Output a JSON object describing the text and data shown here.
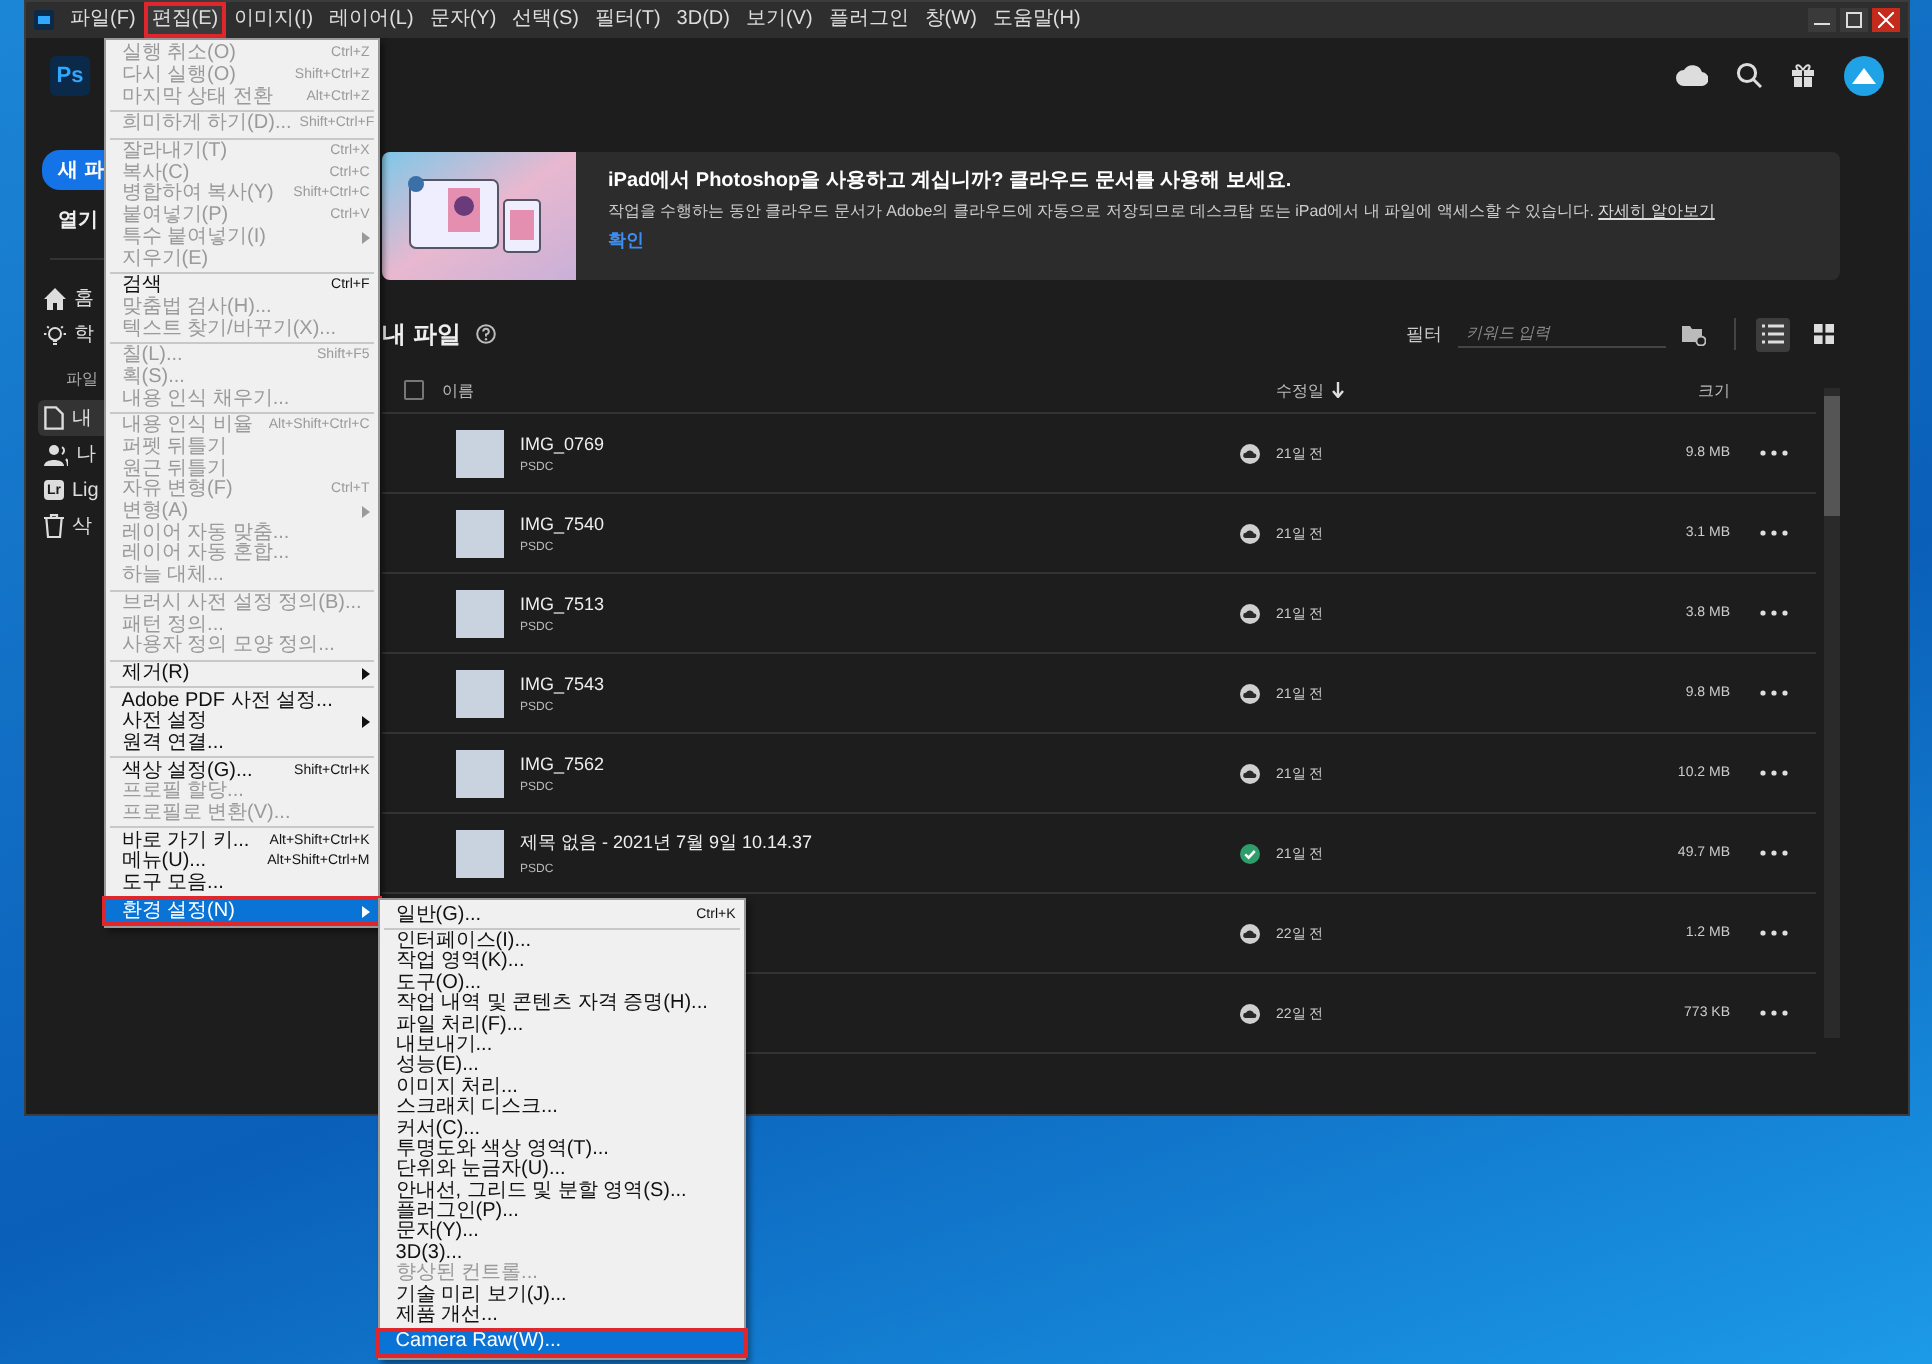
{
  "menu_bar": {
    "items": [
      {
        "label": "파일(F)",
        "selected": false
      },
      {
        "label": "편집(E)",
        "selected": true
      },
      {
        "label": "이미지(I)",
        "selected": false
      },
      {
        "label": "레이어(L)",
        "selected": false
      },
      {
        "label": "문자(Y)",
        "selected": false
      },
      {
        "label": "선택(S)",
        "selected": false
      },
      {
        "label": "필터(T)",
        "selected": false
      },
      {
        "label": "3D(D)",
        "selected": false
      },
      {
        "label": "보기(V)",
        "selected": false
      },
      {
        "label": "플러그인",
        "selected": false
      },
      {
        "label": "창(W)",
        "selected": false
      },
      {
        "label": "도움말(H)",
        "selected": false
      }
    ]
  },
  "edit_menu": {
    "items": [
      {
        "kind": "item",
        "label": "실행 취소(O)",
        "shortcut": "Ctrl+Z",
        "disabled": true,
        "submenu": false,
        "selected": false
      },
      {
        "kind": "item",
        "label": "다시 실행(O)",
        "shortcut": "Shift+Ctrl+Z",
        "disabled": true,
        "submenu": false,
        "selected": false
      },
      {
        "kind": "item",
        "label": "마지막 상태 전환",
        "shortcut": "Alt+Ctrl+Z",
        "disabled": true,
        "submenu": false,
        "selected": false
      },
      {
        "kind": "separator"
      },
      {
        "kind": "item",
        "label": "희미하게 하기(D)...",
        "shortcut": "Shift+Ctrl+F",
        "disabled": true,
        "submenu": false,
        "selected": false
      },
      {
        "kind": "separator"
      },
      {
        "kind": "item",
        "label": "잘라내기(T)",
        "shortcut": "Ctrl+X",
        "disabled": true,
        "submenu": false,
        "selected": false
      },
      {
        "kind": "item",
        "label": "복사(C)",
        "shortcut": "Ctrl+C",
        "disabled": true,
        "submenu": false,
        "selected": false
      },
      {
        "kind": "item",
        "label": "병합하여 복사(Y)",
        "shortcut": "Shift+Ctrl+C",
        "disabled": true,
        "submenu": false,
        "selected": false
      },
      {
        "kind": "item",
        "label": "붙여넣기(P)",
        "shortcut": "Ctrl+V",
        "disabled": true,
        "submenu": false,
        "selected": false
      },
      {
        "kind": "item",
        "label": "특수 붙여넣기(I)",
        "disabled": true,
        "submenu": true,
        "selected": false
      },
      {
        "kind": "item",
        "label": "지우기(E)",
        "disabled": true,
        "submenu": false,
        "selected": false
      },
      {
        "kind": "separator"
      },
      {
        "kind": "item",
        "label": "검색",
        "shortcut": "Ctrl+F",
        "disabled": false,
        "submenu": false,
        "selected": false
      },
      {
        "kind": "item",
        "label": "맞춤법 검사(H)...",
        "disabled": true,
        "submenu": false,
        "selected": false
      },
      {
        "kind": "item",
        "label": "텍스트 찾기/바꾸기(X)...",
        "disabled": true,
        "submenu": false,
        "selected": false
      },
      {
        "kind": "separator"
      },
      {
        "kind": "item",
        "label": "칠(L)...",
        "shortcut": "Shift+F5",
        "disabled": true,
        "submenu": false,
        "selected": false
      },
      {
        "kind": "item",
        "label": "획(S)...",
        "disabled": true,
        "submenu": false,
        "selected": false
      },
      {
        "kind": "item",
        "label": "내용 인식 채우기...",
        "disabled": true,
        "submenu": false,
        "selected": false
      },
      {
        "kind": "separator"
      },
      {
        "kind": "item",
        "label": "내용 인식 비율",
        "shortcut": "Alt+Shift+Ctrl+C",
        "disabled": true,
        "submenu": false,
        "selected": false
      },
      {
        "kind": "item",
        "label": "퍼펫 뒤틀기",
        "disabled": true,
        "submenu": false,
        "selected": false
      },
      {
        "kind": "item",
        "label": "원근 뒤틀기",
        "disabled": true,
        "submenu": false,
        "selected": false
      },
      {
        "kind": "item",
        "label": "자유 변형(F)",
        "shortcut": "Ctrl+T",
        "disabled": true,
        "submenu": false,
        "selected": false
      },
      {
        "kind": "item",
        "label": "변형(A)",
        "disabled": true,
        "submenu": true,
        "selected": false
      },
      {
        "kind": "item",
        "label": "레이어 자동 맞춤...",
        "disabled": true,
        "submenu": false,
        "selected": false
      },
      {
        "kind": "item",
        "label": "레이어 자동 혼합...",
        "disabled": true,
        "submenu": false,
        "selected": false
      },
      {
        "kind": "item",
        "label": "하늘 대체...",
        "disabled": true,
        "submenu": false,
        "selected": false
      },
      {
        "kind": "separator"
      },
      {
        "kind": "item",
        "label": "브러시 사전 설정 정의(B)...",
        "disabled": true,
        "submenu": false,
        "selected": false
      },
      {
        "kind": "item",
        "label": "패턴 정의...",
        "disabled": true,
        "submenu": false,
        "selected": false
      },
      {
        "kind": "item",
        "label": "사용자 정의 모양 정의...",
        "disabled": true,
        "submenu": false,
        "selected": false
      },
      {
        "kind": "separator"
      },
      {
        "kind": "item",
        "label": "제거(R)",
        "disabled": false,
        "submenu": true,
        "selected": false
      },
      {
        "kind": "separator"
      },
      {
        "kind": "item",
        "label": "Adobe PDF 사전 설정...",
        "disabled": false,
        "submenu": false,
        "selected": false
      },
      {
        "kind": "item",
        "label": "사전 설정",
        "disabled": false,
        "submenu": true,
        "selected": false
      },
      {
        "kind": "item",
        "label": "원격 연결...",
        "disabled": false,
        "submenu": false,
        "selected": false
      },
      {
        "kind": "separator"
      },
      {
        "kind": "item",
        "label": "색상 설정(G)...",
        "shortcut": "Shift+Ctrl+K",
        "disabled": false,
        "submenu": false,
        "selected": false
      },
      {
        "kind": "item",
        "label": "프로필 할당...",
        "disabled": true,
        "submenu": false,
        "selected": false
      },
      {
        "kind": "item",
        "label": "프로필로 변환(V)...",
        "disabled": true,
        "submenu": false,
        "selected": false
      },
      {
        "kind": "separator"
      },
      {
        "kind": "item",
        "label": "바로 가기 키...",
        "shortcut": "Alt+Shift+Ctrl+K",
        "disabled": false,
        "submenu": false,
        "selected": false
      },
      {
        "kind": "item",
        "label": "메뉴(U)...",
        "shortcut": "Alt+Shift+Ctrl+M",
        "disabled": false,
        "submenu": false,
        "selected": false
      },
      {
        "kind": "item",
        "label": "도구 모음...",
        "disabled": false,
        "submenu": false,
        "selected": false
      },
      {
        "kind": "separator"
      },
      {
        "kind": "item",
        "label": "환경 설정(N)",
        "disabled": false,
        "submenu": true,
        "selected": true
      }
    ]
  },
  "preferences_submenu": {
    "items": [
      {
        "kind": "item",
        "label": "일반(G)...",
        "shortcut": "Ctrl+K",
        "disabled": false,
        "selected": false
      },
      {
        "kind": "separator"
      },
      {
        "kind": "item",
        "label": "인터페이스(I)...",
        "disabled": false,
        "selected": false
      },
      {
        "kind": "item",
        "label": "작업 영역(K)...",
        "disabled": false,
        "selected": false
      },
      {
        "kind": "item",
        "label": "도구(O)...",
        "disabled": false,
        "selected": false
      },
      {
        "kind": "item",
        "label": "작업 내역 및 콘텐츠 자격 증명(H)...",
        "disabled": false,
        "selected": false
      },
      {
        "kind": "item",
        "label": "파일 처리(F)...",
        "disabled": false,
        "selected": false
      },
      {
        "kind": "item",
        "label": "내보내기...",
        "disabled": false,
        "selected": false
      },
      {
        "kind": "item",
        "label": "성능(E)...",
        "disabled": false,
        "selected": false
      },
      {
        "kind": "item",
        "label": "이미지 처리...",
        "disabled": false,
        "selected": false
      },
      {
        "kind": "item",
        "label": "스크래치 디스크...",
        "disabled": false,
        "selected": false
      },
      {
        "kind": "item",
        "label": "커서(C)...",
        "disabled": false,
        "selected": false
      },
      {
        "kind": "item",
        "label": "투명도와 색상 영역(T)...",
        "disabled": false,
        "selected": false
      },
      {
        "kind": "item",
        "label": "단위와 눈금자(U)...",
        "disabled": false,
        "selected": false
      },
      {
        "kind": "item",
        "label": "안내선, 그리드 및 분할 영역(S)...",
        "disabled": false,
        "selected": false
      },
      {
        "kind": "item",
        "label": "플러그인(P)...",
        "disabled": false,
        "selected": false
      },
      {
        "kind": "item",
        "label": "문자(Y)...",
        "disabled": false,
        "selected": false
      },
      {
        "kind": "item",
        "label": "3D(3)...",
        "disabled": false,
        "selected": false
      },
      {
        "kind": "item",
        "label": "향상된 컨트롤...",
        "disabled": true,
        "selected": false
      },
      {
        "kind": "item",
        "label": "기술 미리 보기(J)...",
        "disabled": false,
        "selected": false
      },
      {
        "kind": "item",
        "label": "제품 개선...",
        "disabled": false,
        "selected": false
      },
      {
        "kind": "separator"
      },
      {
        "kind": "item",
        "label": "Camera Raw(W)...",
        "disabled": false,
        "selected": true
      }
    ]
  },
  "app_header": {
    "logo": "Ps"
  },
  "sidebar": {
    "new_button": "새 파",
    "open_button": "열기",
    "items": [
      {
        "label": "홈",
        "selected": false
      },
      {
        "label": "학",
        "selected": false
      }
    ],
    "section": "파일",
    "file_items": [
      {
        "label": "내",
        "selected": true
      },
      {
        "label": "나",
        "selected": false
      },
      {
        "label": "Lig",
        "selected": false,
        "icon_text": "Lr"
      },
      {
        "label": "삭",
        "selected": false
      }
    ]
  },
  "banner": {
    "title": "iPad에서 Photoshop을 사용하고 계십니까? 클라우드 문서를 사용해 보세요.",
    "description": "작업을 수행하는 동안 클라우드 문서가 Adobe의 클라우드에 자동으로 저장되므로 데스크탑 또는 iPad에서 내 파일에 액세스할 수 있습니다.",
    "link": "자세히 알아보기",
    "action": "확인"
  },
  "files": {
    "title": "내 파일",
    "filter_label": "필터",
    "filter_placeholder": "키워드 입력",
    "view_buttons": [
      {
        "kind": "list",
        "selected": true
      },
      {
        "kind": "grid",
        "selected": false
      }
    ],
    "select_all_checked": false,
    "columns": [
      "이름",
      "수정일",
      "크기"
    ],
    "rows": [
      {
        "name": "IMG_0769",
        "type": "PSDC",
        "kind": "cloud",
        "modified": "21일 전",
        "size": "9.8 MB"
      },
      {
        "name": "IMG_7540",
        "type": "PSDC",
        "kind": "cloud",
        "modified": "21일 전",
        "size": "3.1 MB"
      },
      {
        "name": "IMG_7513",
        "type": "PSDC",
        "kind": "cloud",
        "modified": "21일 전",
        "size": "3.8 MB"
      },
      {
        "name": "IMG_7543",
        "type": "PSDC",
        "kind": "cloud",
        "modified": "21일 전",
        "size": "9.8 MB"
      },
      {
        "name": "IMG_7562",
        "type": "PSDC",
        "kind": "cloud",
        "modified": "21일 전",
        "size": "10.2 MB"
      },
      {
        "name": "제목 없음 - 2021년 7월 9일 10.14.37",
        "type": "PSDC",
        "kind": "synced",
        "modified": "21일 전",
        "size": "49.7 MB"
      },
      {
        "kind": "cloud",
        "modified": "22일 전",
        "size": "1.2 MB"
      },
      {
        "kind": "cloud",
        "modified": "22일 전",
        "size": "773 KB"
      }
    ]
  }
}
